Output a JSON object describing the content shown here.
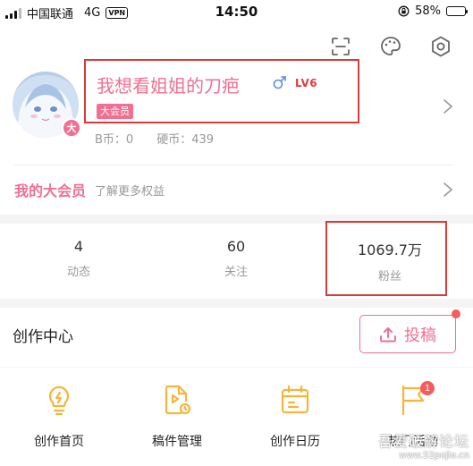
{
  "status_bar": {
    "carrier": "中国联通",
    "network": "4G",
    "vpn": "VPN",
    "time": "14:50",
    "battery_percent": "58%",
    "battery_level": 0.58
  },
  "top_icons": [
    "scan-icon",
    "palette-icon",
    "settings-icon"
  ],
  "profile": {
    "username": "我想看姐姐的刀疤",
    "level": "LV6",
    "vip_tag": "大会员",
    "vip_mark": "大",
    "b_coins_label": "B币：",
    "b_coins": "0",
    "hard_coins_label": "硬币：",
    "hard_coins": "439"
  },
  "vip": {
    "title": "我的大会员",
    "subtitle": "了解更多权益"
  },
  "stats": [
    {
      "value": "4",
      "label": "动态"
    },
    {
      "value": "60",
      "label": "关注"
    },
    {
      "value": "1069.7万",
      "label": "粉丝"
    }
  ],
  "creation": {
    "title": "创作中心",
    "submit_label": "投稿",
    "tools": [
      {
        "label": "创作首页",
        "icon": "bulb-icon"
      },
      {
        "label": "稿件管理",
        "icon": "video-file-icon"
      },
      {
        "label": "创作日历",
        "icon": "calendar-icon"
      },
      {
        "label": "热门活动",
        "icon": "flag-icon",
        "badge": "1"
      }
    ]
  },
  "watermark": {
    "line1": "吾爱破解论坛",
    "line2": "www.52pojie.cn"
  },
  "colors": {
    "accent": "#f06f92",
    "annotation": "#d93a3a",
    "icon_gold": "#f4b63a",
    "badge": "#f25d5d"
  }
}
